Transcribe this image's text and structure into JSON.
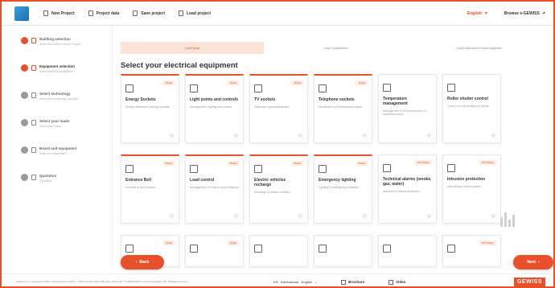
{
  "topbar": {
    "items": [
      {
        "label": "New Project"
      },
      {
        "label": "Project data"
      },
      {
        "label": "Save project"
      },
      {
        "label": "Load project"
      }
    ],
    "language": "English",
    "gewiss_link": "Browse e-GEWISS"
  },
  "sidebar": {
    "steps": [
      {
        "title": "Building selection",
        "desc": "Select the context of your Project"
      },
      {
        "title": "Equipment selection",
        "desc": "Select electrical equipment"
      },
      {
        "title": "Select technology",
        "desc": "Select the technology you wish"
      },
      {
        "title": "Select your loads",
        "desc": "Select your loads"
      },
      {
        "title": "Board and equipment",
        "desc": "Board and equipment"
      },
      {
        "title": "Quotation",
        "desc": "Quotation"
      }
    ]
  },
  "progress_tabs": [
    {
      "label": "Load Types"
    },
    {
      "label": "Load Combinations"
    },
    {
      "label": "Load Collocation in home equipment"
    }
  ],
  "heading": "Select your electrical equipment",
  "cards": [
    {
      "title": "Energy Sockets",
      "desc": "Energy distribution through sockets",
      "badge": "BASE",
      "icon": "socket-icon",
      "selected": true
    },
    {
      "title": "Light points and controls",
      "desc": "Management, lighting and control",
      "badge": "BASE",
      "icon": "bulb-icon",
      "selected": true
    },
    {
      "title": "TV sockets",
      "desc": "Television signal distribution",
      "badge": "BASE",
      "icon": "tv-icon",
      "selected": true
    },
    {
      "title": "Telephone sockets",
      "desc": "Distribution of the telephone signal",
      "badge": "BASE",
      "icon": "phone-icon",
      "selected": true
    },
    {
      "title": "Temperature management",
      "desc": "Management of the temperature in individual rooms",
      "badge": "",
      "icon": "thermometer-icon",
      "selected": false
    },
    {
      "title": "Roller shutter control",
      "desc": "Control of roller shutters or blinds",
      "badge": "",
      "icon": "shutter-icon",
      "selected": false
    },
    {
      "title": "Entrance Bell",
      "desc": "Doorbell at the entrance",
      "badge": "BASE",
      "icon": "bell-icon",
      "selected": true
    },
    {
      "title": "Load control",
      "desc": "Management of loads to avoid blackout",
      "badge": "BASE",
      "icon": "load-icon",
      "selected": true
    },
    {
      "title": "Electric vehicles recharge",
      "desc": "Recharge of electric vehicles",
      "badge": "BASE",
      "icon": "ev-icon",
      "selected": true
    },
    {
      "title": "Emergency lighting",
      "desc": "Lighting in emergency situations",
      "badge": "BASE",
      "icon": "emergency-icon",
      "selected": true
    },
    {
      "title": "Technical alarms (smoke, gas, water)",
      "desc": "Detection of technical alarms",
      "badge": "OPTIONAL",
      "icon": "alarm-icon",
      "selected": false
    },
    {
      "title": "Intrusion protection",
      "desc": "Anti-intrusion alarm system",
      "badge": "OPTIONAL",
      "icon": "intrusion-icon",
      "selected": false
    },
    {
      "title": "",
      "desc": "",
      "badge": "BASE",
      "icon": "calendar-icon",
      "selected": false
    },
    {
      "title": "",
      "desc": "",
      "badge": "BASE",
      "icon": "panel-icon",
      "selected": false
    },
    {
      "title": "",
      "desc": "",
      "badge": "",
      "icon": "blank-icon",
      "selected": false
    },
    {
      "title": "",
      "desc": "",
      "badge": "",
      "icon": "device-icon",
      "selected": false
    },
    {
      "title": "",
      "desc": "",
      "badge": "",
      "icon": "tower-icon",
      "selected": false
    },
    {
      "title": "",
      "desc": "",
      "badge": "OPTIONAL",
      "icon": "window-icon",
      "selected": false
    }
  ],
  "buttons": {
    "back": "Back",
    "next": "Next"
  },
  "footer": {
    "note": "Gewiss S.p.A. Registered Office: Via Alessandro Volta 1 - 24069 Cenate Sotto (BG) Italy. VAT Code: IT 00385040167. Company Register BG. All Rights reserved.",
    "language": "EN · International · English",
    "brochure": "Brochure",
    "video": "Video",
    "logo": "GEWISS"
  },
  "colors": {
    "accent": "#e8502a",
    "muted": "#9a9a9a"
  }
}
